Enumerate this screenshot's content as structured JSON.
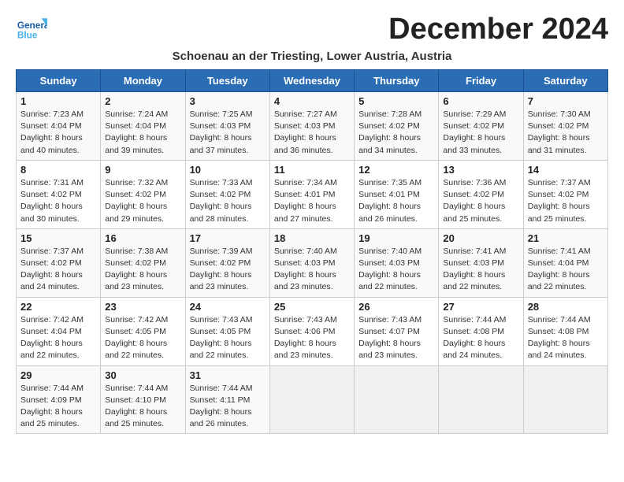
{
  "header": {
    "logo_text1": "General",
    "logo_text2": "Blue",
    "month_year": "December 2024",
    "subtitle": "Schoenau an der Triesting, Lower Austria, Austria"
  },
  "days_of_week": [
    "Sunday",
    "Monday",
    "Tuesday",
    "Wednesday",
    "Thursday",
    "Friday",
    "Saturday"
  ],
  "weeks": [
    [
      {
        "day": 1,
        "sunrise": "7:23 AM",
        "sunset": "4:04 PM",
        "daylight": "8 hours and 40 minutes."
      },
      {
        "day": 2,
        "sunrise": "7:24 AM",
        "sunset": "4:04 PM",
        "daylight": "8 hours and 39 minutes."
      },
      {
        "day": 3,
        "sunrise": "7:25 AM",
        "sunset": "4:03 PM",
        "daylight": "8 hours and 37 minutes."
      },
      {
        "day": 4,
        "sunrise": "7:27 AM",
        "sunset": "4:03 PM",
        "daylight": "8 hours and 36 minutes."
      },
      {
        "day": 5,
        "sunrise": "7:28 AM",
        "sunset": "4:02 PM",
        "daylight": "8 hours and 34 minutes."
      },
      {
        "day": 6,
        "sunrise": "7:29 AM",
        "sunset": "4:02 PM",
        "daylight": "8 hours and 33 minutes."
      },
      {
        "day": 7,
        "sunrise": "7:30 AM",
        "sunset": "4:02 PM",
        "daylight": "8 hours and 31 minutes."
      }
    ],
    [
      {
        "day": 8,
        "sunrise": "7:31 AM",
        "sunset": "4:02 PM",
        "daylight": "8 hours and 30 minutes."
      },
      {
        "day": 9,
        "sunrise": "7:32 AM",
        "sunset": "4:02 PM",
        "daylight": "8 hours and 29 minutes."
      },
      {
        "day": 10,
        "sunrise": "7:33 AM",
        "sunset": "4:02 PM",
        "daylight": "8 hours and 28 minutes."
      },
      {
        "day": 11,
        "sunrise": "7:34 AM",
        "sunset": "4:01 PM",
        "daylight": "8 hours and 27 minutes."
      },
      {
        "day": 12,
        "sunrise": "7:35 AM",
        "sunset": "4:01 PM",
        "daylight": "8 hours and 26 minutes."
      },
      {
        "day": 13,
        "sunrise": "7:36 AM",
        "sunset": "4:02 PM",
        "daylight": "8 hours and 25 minutes."
      },
      {
        "day": 14,
        "sunrise": "7:37 AM",
        "sunset": "4:02 PM",
        "daylight": "8 hours and 25 minutes."
      }
    ],
    [
      {
        "day": 15,
        "sunrise": "7:37 AM",
        "sunset": "4:02 PM",
        "daylight": "8 hours and 24 minutes."
      },
      {
        "day": 16,
        "sunrise": "7:38 AM",
        "sunset": "4:02 PM",
        "daylight": "8 hours and 23 minutes."
      },
      {
        "day": 17,
        "sunrise": "7:39 AM",
        "sunset": "4:02 PM",
        "daylight": "8 hours and 23 minutes."
      },
      {
        "day": 18,
        "sunrise": "7:40 AM",
        "sunset": "4:03 PM",
        "daylight": "8 hours and 23 minutes."
      },
      {
        "day": 19,
        "sunrise": "7:40 AM",
        "sunset": "4:03 PM",
        "daylight": "8 hours and 22 minutes."
      },
      {
        "day": 20,
        "sunrise": "7:41 AM",
        "sunset": "4:03 PM",
        "daylight": "8 hours and 22 minutes."
      },
      {
        "day": 21,
        "sunrise": "7:41 AM",
        "sunset": "4:04 PM",
        "daylight": "8 hours and 22 minutes."
      }
    ],
    [
      {
        "day": 22,
        "sunrise": "7:42 AM",
        "sunset": "4:04 PM",
        "daylight": "8 hours and 22 minutes."
      },
      {
        "day": 23,
        "sunrise": "7:42 AM",
        "sunset": "4:05 PM",
        "daylight": "8 hours and 22 minutes."
      },
      {
        "day": 24,
        "sunrise": "7:43 AM",
        "sunset": "4:05 PM",
        "daylight": "8 hours and 22 minutes."
      },
      {
        "day": 25,
        "sunrise": "7:43 AM",
        "sunset": "4:06 PM",
        "daylight": "8 hours and 23 minutes."
      },
      {
        "day": 26,
        "sunrise": "7:43 AM",
        "sunset": "4:07 PM",
        "daylight": "8 hours and 23 minutes."
      },
      {
        "day": 27,
        "sunrise": "7:44 AM",
        "sunset": "4:08 PM",
        "daylight": "8 hours and 24 minutes."
      },
      {
        "day": 28,
        "sunrise": "7:44 AM",
        "sunset": "4:08 PM",
        "daylight": "8 hours and 24 minutes."
      }
    ],
    [
      {
        "day": 29,
        "sunrise": "7:44 AM",
        "sunset": "4:09 PM",
        "daylight": "8 hours and 25 minutes."
      },
      {
        "day": 30,
        "sunrise": "7:44 AM",
        "sunset": "4:10 PM",
        "daylight": "8 hours and 25 minutes."
      },
      {
        "day": 31,
        "sunrise": "7:44 AM",
        "sunset": "4:11 PM",
        "daylight": "8 hours and 26 minutes."
      },
      null,
      null,
      null,
      null
    ]
  ]
}
